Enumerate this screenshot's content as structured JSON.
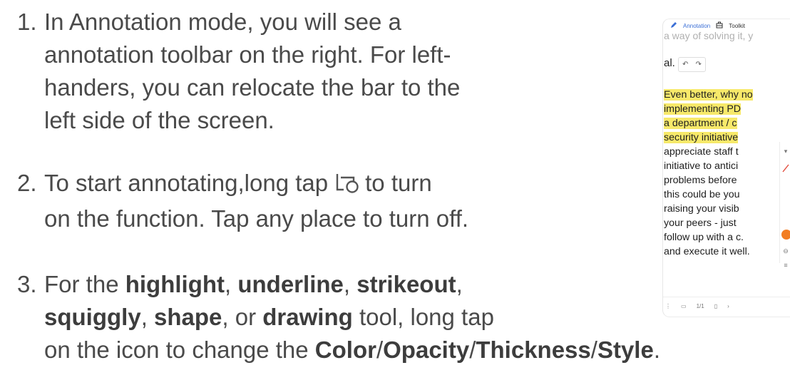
{
  "steps": [
    {
      "number": "1.",
      "lines": [
        "In Annotation mode, you will see a",
        "annotation toolbar on the right. For left-",
        "handers, you can relocate the bar to the",
        "left side of the screen."
      ]
    },
    {
      "number": "2.",
      "line1_before": "To start annotating,long tap",
      "line1_after": "to turn",
      "line2": "on the function. Tap any place to turn off.",
      "icon": "crop-circle-icon"
    },
    {
      "number": "3.",
      "prefix": "For the",
      "tools": [
        "highlight",
        "underline",
        "strikeout",
        "squiggly",
        "shape",
        "drawing"
      ],
      "sep_comma": ",",
      "sep_or": ", or",
      "tool_suffix": "tool, long tap",
      "line3_prefix": "on the icon to change the",
      "options": [
        "Color",
        "Opacity",
        "Thickness",
        "Style"
      ],
      "slash": "/",
      "period": "."
    }
  ],
  "screenshot": {
    "annotation_label": "Annotation",
    "toolkit_label": "Toolkit",
    "faded_text": "a way of solving it, y",
    "al_text": "al.",
    "undo_icon": "undo-icon",
    "redo_icon": "redo-icon",
    "doc_lines": [
      {
        "text": "Even better, why no",
        "highlight": true
      },
      {
        "text": "implementing PD",
        "highlight": true
      },
      {
        "text": "a department / c",
        "highlight": true
      },
      {
        "text": "security initiative",
        "highlight": true
      },
      {
        "text": "appreciate staff t",
        "highlight": false
      },
      {
        "text": "initiative to antici",
        "highlight": false
      },
      {
        "text": "problems before",
        "highlight": false
      },
      {
        "text": "this could be you",
        "highlight": false
      },
      {
        "text": "raising your visib",
        "highlight": false
      },
      {
        "text": "your peers - just",
        "highlight": false
      },
      {
        "text": "follow up with a c.",
        "highlight": false
      },
      {
        "text": "and execute it well.",
        "highlight": false
      }
    ],
    "page_indicator": "1/1",
    "highlight_color": "#f7e96a",
    "accent_color": "#f27d22"
  }
}
